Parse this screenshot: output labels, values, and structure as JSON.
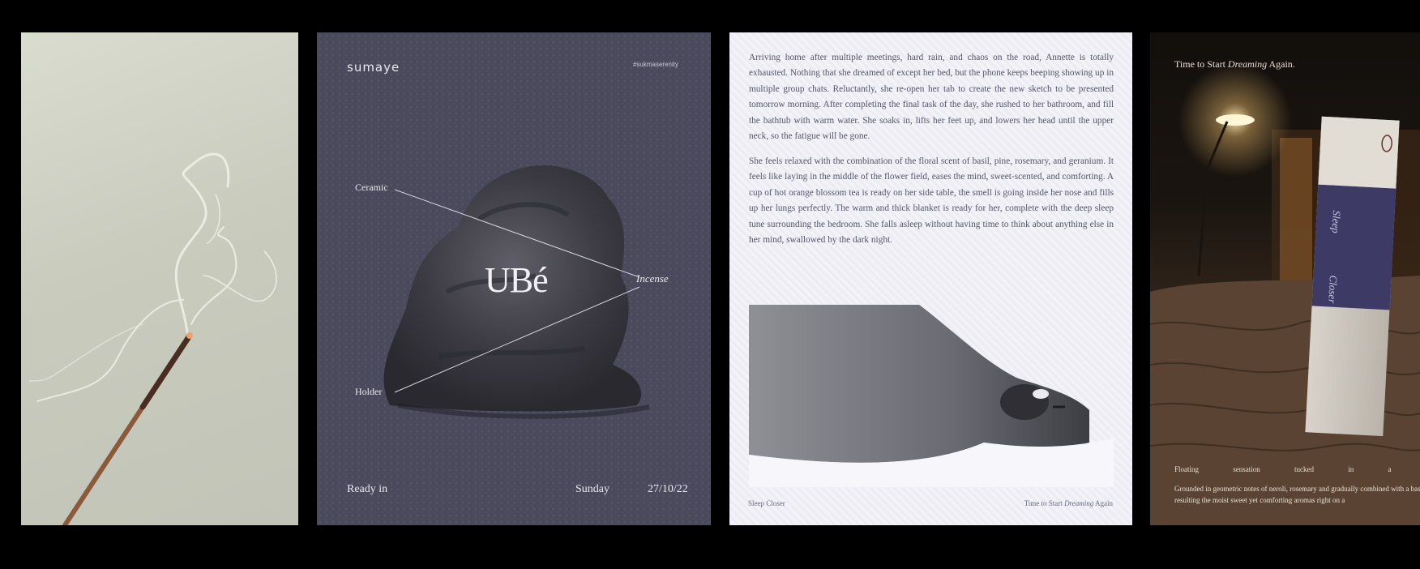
{
  "panel_poster": {
    "logo": "sumaye",
    "tag": "#sukmaserenity",
    "labels": {
      "ceramic": "Ceramic",
      "incense": "Incense",
      "holder": "Holder"
    },
    "title": "UBé",
    "footer": {
      "ready": "Ready in",
      "day": "Sunday",
      "date": "27/10/22"
    },
    "colors": {
      "background": "#4b4a5c",
      "text": "#e9e7ee"
    }
  },
  "panel_text": {
    "paragraph1": "Arriving home after multiple meetings, hard rain, and chaos on the road, Annette is totally exhausted. Nothing that she dreamed of except her bed, but the phone keeps beeping showing up in multiple group chats. Reluctantly, she re-open her tab to create the new sketch to be presented tomorrow morning. After completing the final task of the day, she rushed to her bathroom, and fill the bathtub with warm water. She soaks in, lifts her feet up, and lowers her head until the upper neck, so the fatigue will be gone.",
    "paragraph2": "She feels relaxed with the combination of the floral scent of basil, pine, rosemary, and geranium. It feels like laying in the middle of the flower field, eases the mind, sweet-scented, and comforting. A cup of hot orange blossom tea is ready on her side table, the smell is going inside her nose and fills up her lungs perfectly. The warm and thick blanket is ready for her, complete with the deep sleep tune surrounding the bedroom. She falls asleep without having time to think about anything else in her mind, swallowed by the dark night.",
    "footer_left": "Sleep Closer",
    "footer_right_prefix": "Time to Start",
    "footer_right_italic": "Dreaming",
    "footer_right_suffix": "Again"
  },
  "panel_bedroom": {
    "title_prefix": "Time to Start",
    "title_italic": "Dreaming",
    "title_suffix": "Again.",
    "caption_line1": "Floating sensation tucked in a",
    "caption_line2": "Grounded in geometric notes of neroli, rosemary and gradually combined with a base, resulting the moist sweet yet comforting aromas right on a",
    "box_text_top": "Sleep",
    "box_text_bottom": "Closer"
  }
}
